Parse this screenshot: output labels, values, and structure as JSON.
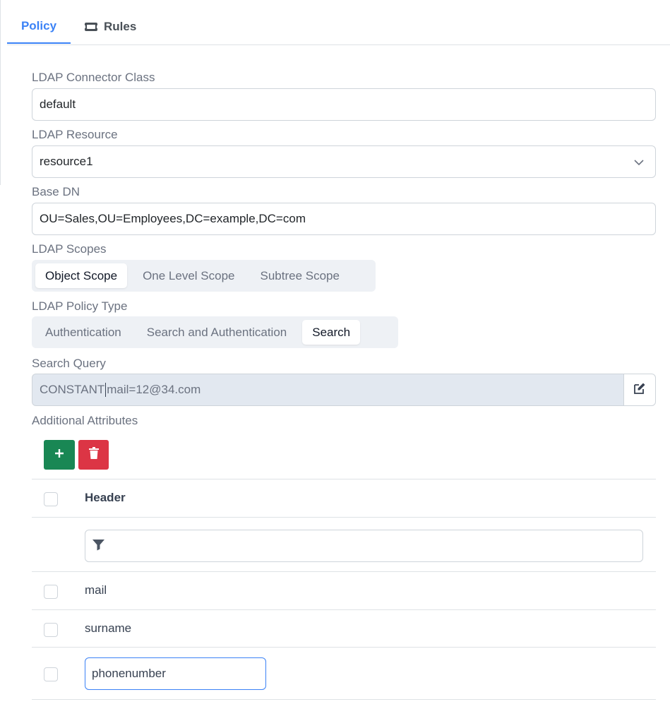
{
  "tabs": {
    "policy_label": "Policy",
    "rules_label": "Rules"
  },
  "form": {
    "connector_class": {
      "label": "LDAP Connector Class",
      "value": "default"
    },
    "resource": {
      "label": "LDAP Resource",
      "value": "resource1"
    },
    "base_dn": {
      "label": "Base DN",
      "value": "OU=Sales,OU=Employees,DC=example,DC=com"
    },
    "scopes": {
      "label": "LDAP Scopes",
      "options": [
        "Object Scope",
        "One Level Scope",
        "Subtree Scope"
      ],
      "selected": "Object Scope"
    },
    "policy_type": {
      "label": "LDAP Policy Type",
      "options": [
        "Authentication",
        "Search and Authentication",
        "Search"
      ],
      "selected": "Search"
    },
    "search_query": {
      "label": "Search Query",
      "value_prefix": "CONSTANT",
      "value_suffix": "mail=12@34.com"
    },
    "additional_attributes": {
      "label": "Additional Attributes"
    }
  },
  "table": {
    "header": "Header",
    "rows": [
      "mail",
      "surname",
      "phonenumber"
    ]
  },
  "icons": {
    "rules_tab": "ticket-icon",
    "chevron": "chevron-down-icon",
    "edit": "edit-icon",
    "add": "plus-icon",
    "delete": "trash-icon",
    "filter": "filter-icon"
  },
  "colors": {
    "accent": "#3b82f6",
    "add_button": "#198754",
    "delete_button": "#dc3545",
    "readonly_bg": "#e2e8f0"
  }
}
